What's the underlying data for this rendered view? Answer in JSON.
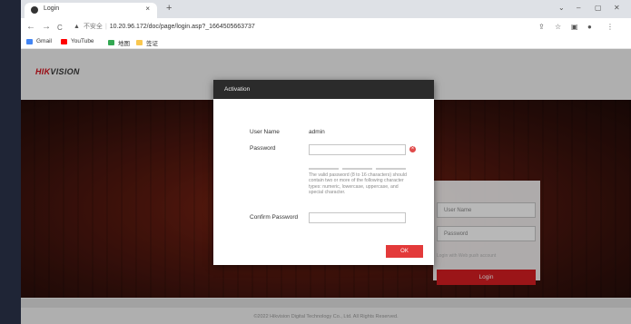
{
  "browser": {
    "tab_title": "Login",
    "tab_close": "×",
    "new_tab": "+",
    "window_controls": [
      "⌄",
      "–",
      "▢",
      "✕"
    ],
    "nav": {
      "back": "←",
      "forward": "→",
      "reload": "C"
    },
    "address": {
      "warning": "▲",
      "security_label": "不安全",
      "url": "10.20.96.172/doc/page/login.asp?_1664505663737"
    },
    "toolbar_icons": [
      "⇪",
      "☆",
      "▣",
      "●",
      "⋮"
    ],
    "bookmarks": [
      {
        "label": "Gmail",
        "color": "#4285f4"
      },
      {
        "label": "YouTube",
        "color": "#ff0000"
      },
      {
        "label": "地图",
        "color": "#34a853"
      },
      {
        "label": "签证",
        "color": "#f9c74f"
      }
    ]
  },
  "page": {
    "logo": {
      "part1": "HIK",
      "part2": "VISION"
    },
    "footer": "©2022 Hikvision Digital Technology Co., Ltd. All Rights Reserved.",
    "login_panel": {
      "username_placeholder": "User Name",
      "password_placeholder": "Password",
      "remember_text": "Login with Web push account",
      "login_button": "Login"
    }
  },
  "modal": {
    "title": "Activation",
    "username_label": "User Name",
    "username_value": "admin",
    "password_label": "Password",
    "error_icon": "×",
    "hint": "The valid password (8 to 16 characters) should contain two or more of the following character types: numeric, lowercase, uppercase, and special character.",
    "confirm_label": "Confirm Password",
    "ok_button": "OK"
  },
  "colors": {
    "brand_red": "#d40f1a",
    "ok_button": "#e33a3a",
    "modal_header": "#2b2b2b"
  }
}
